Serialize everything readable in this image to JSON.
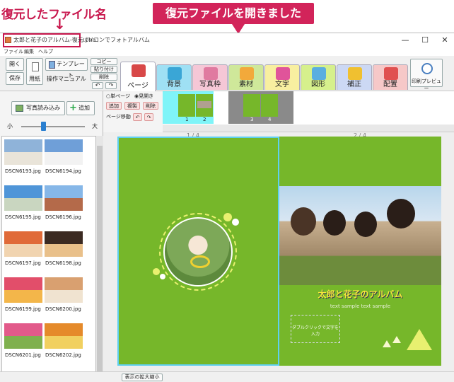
{
  "annotations": {
    "restored_filename_label": "復元したファイル名",
    "arrow": "↓",
    "restored_opened_banner": "復元ファイルを開きました"
  },
  "window": {
    "title_file": "太郎と花子のアルバム-復元.pha",
    "title_app": "パソコンでフォトアルバム",
    "min_glyph": "—",
    "max_glyph": "☐",
    "close_glyph": "✕"
  },
  "menu": [
    "ファイル",
    "編集",
    "ヘルプ"
  ],
  "toolbar": {
    "open": "開く",
    "save": "保存",
    "paper": "用紙",
    "template": "テンプレート",
    "manual": "操作マニュアル",
    "copy": "コピー",
    "paste": "貼り付け",
    "delete": "削除",
    "undo": "↶",
    "redo": "↷",
    "print_preview": "印刷プレビュー"
  },
  "tabs": [
    {
      "label": "ページ",
      "color": "#ffffff",
      "icon_color": "#d84848",
      "active": true
    },
    {
      "label": "背景",
      "color": "#9fe0f4",
      "icon_color": "#3aa6d6"
    },
    {
      "label": "写真枠",
      "color": "#f5c7d6",
      "icon_color": "#e07aa0"
    },
    {
      "label": "素材",
      "color": "#cfe89a",
      "icon_color": "#f2a93b"
    },
    {
      "label": "文字",
      "color": "#f8efa0",
      "icon_color": "#e0549a"
    },
    {
      "label": "図形",
      "color": "#d6f08c",
      "icon_color": "#5aaee0"
    },
    {
      "label": "補正",
      "color": "#ccd8f4",
      "icon_color": "#f0c030"
    },
    {
      "label": "配置",
      "color": "#f6c8c8",
      "icon_color": "#e05050"
    }
  ],
  "left": {
    "load_photos": "写真読み込み",
    "add": "追加",
    "size_small": "小",
    "size_large": "大",
    "photos": [
      {
        "name": "DSCN6193.jpg",
        "c1": "#8fb3d9",
        "c2": "#e9e4d9"
      },
      {
        "name": "DSCN6194.jpg",
        "c1": "#6f9fd8",
        "c2": "#f2f2f2"
      },
      {
        "name": "DSCN6195.jpg",
        "c1": "#4f95d8",
        "c2": "#c9d6c0"
      },
      {
        "name": "DSCN6196.jpg",
        "c1": "#86b7e8",
        "c2": "#b46a4a"
      },
      {
        "name": "DSCN6197.jpg",
        "c1": "#e06a38",
        "c2": "#f1d4b0"
      },
      {
        "name": "DSCN6198.jpg",
        "c1": "#3b2a22",
        "c2": "#e9c08a"
      },
      {
        "name": "DSCN6199.jpg",
        "c1": "#e24e6a",
        "c2": "#f3b64a"
      },
      {
        "name": "DSCN6200.jpg",
        "c1": "#d9a070",
        "c2": "#f0e3d0"
      },
      {
        "name": "DSCN6201.jpg",
        "c1": "#e25a8a",
        "c2": "#7fb04e"
      },
      {
        "name": "DSCN6202.jpg",
        "c1": "#e58a2a",
        "c2": "#f1d060"
      }
    ]
  },
  "pagectl": {
    "single": "○単ページ",
    "spread": "◉見開き",
    "add": "追加",
    "dup": "複製",
    "del": "削除",
    "move": "ページ移動"
  },
  "strip": {
    "pages": [
      "1",
      "2",
      "3",
      "4"
    ]
  },
  "canvas": {
    "page_label_left": "1 / 4",
    "page_label_right": "2 / 4",
    "album_title": "太郎と花子のアルバム",
    "sample_text": "text sample text sample",
    "textbox_placeholder": "ダブルクリックで文字を入力"
  },
  "status": {
    "zoom": "表示の拡大縮小"
  },
  "colors": {
    "accent": "#d2245a",
    "page_green": "#76b72a",
    "selection": "#5fd0f0"
  }
}
